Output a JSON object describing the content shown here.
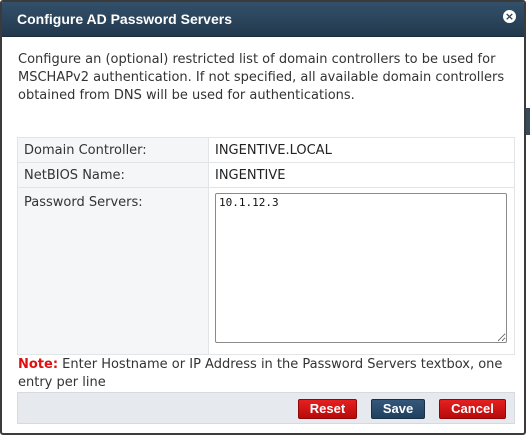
{
  "dialog": {
    "title": "Configure AD Password Servers",
    "close_icon": "×",
    "description": "Configure an (optional) restricted list of domain controllers to be used for MSCHAPv2 authentication. If not specified, all available domain controllers obtained from DNS will be used for authentications."
  },
  "form": {
    "domain_controller": {
      "label": "Domain Controller:",
      "value": "INGENTIVE.LOCAL"
    },
    "netbios_name": {
      "label": "NetBIOS Name:",
      "value": "INGENTIVE"
    },
    "password_servers": {
      "label": "Password Servers:",
      "value": "10.1.12.3"
    }
  },
  "note": {
    "label": "Note:",
    "text": " Enter Hostname or IP Address in the Password Servers textbox, one entry per line"
  },
  "buttons": {
    "reset": "Reset",
    "save": "Save",
    "cancel": "Cancel"
  },
  "colors": {
    "title_bar": "#2a4259",
    "note_label": "#e01010",
    "reset_cancel": "#d41414",
    "save": "#2a4a6b"
  }
}
